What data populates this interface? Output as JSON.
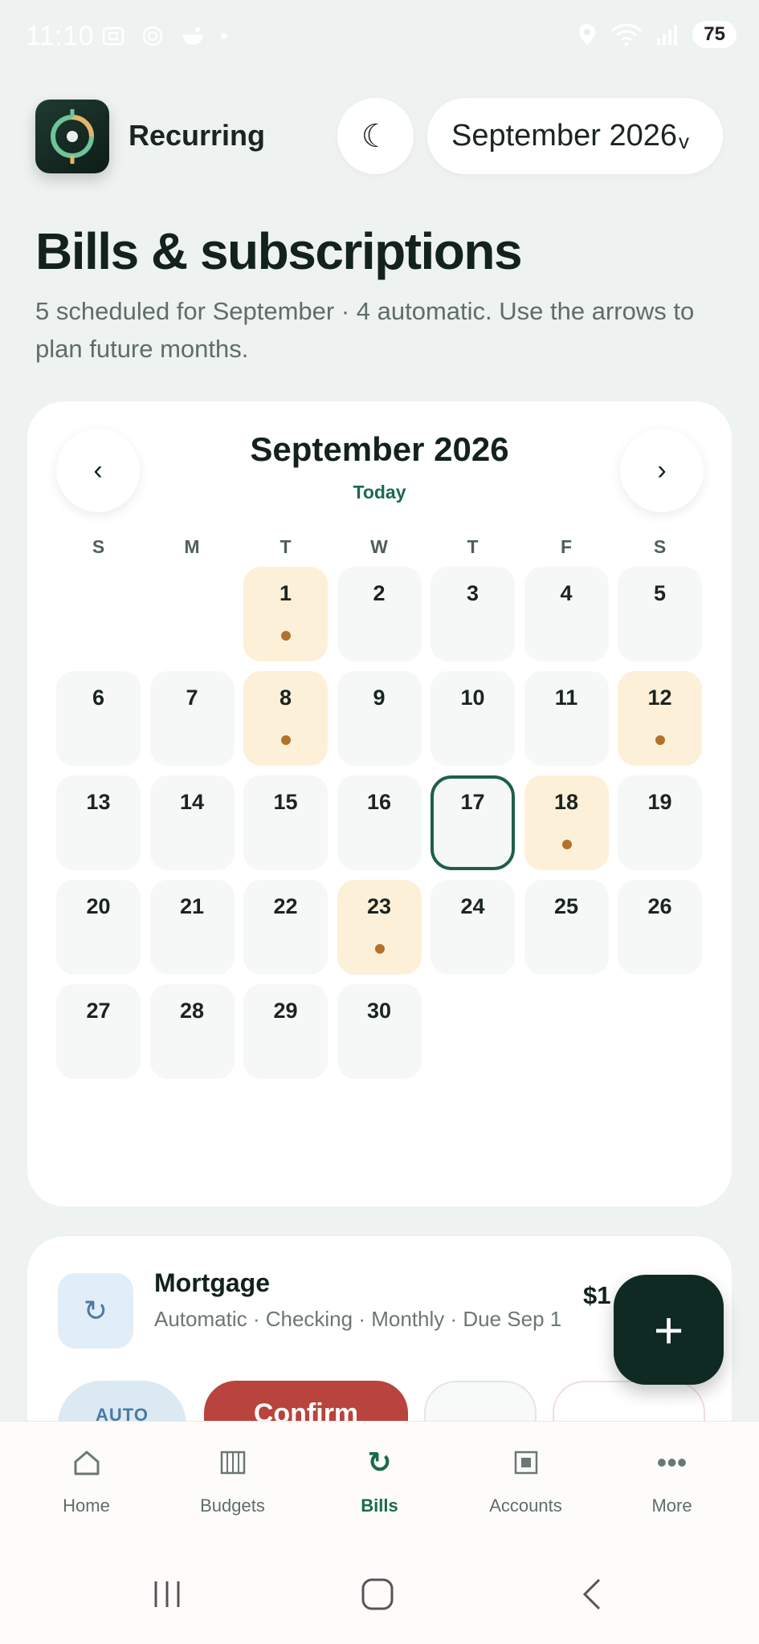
{
  "status_bar": {
    "time": "11:10",
    "battery": "75",
    "left_icons": [
      "screenshot-icon",
      "openai-icon",
      "bowl-icon",
      "dot-icon"
    ],
    "right_icons": [
      "location-icon",
      "wifi-icon",
      "signal-icon"
    ]
  },
  "header": {
    "app_name": "Recurring",
    "theme_icon": "☾",
    "month_selector": "September 2026",
    "month_selector_chevron": "v"
  },
  "page": {
    "title": "Bills & subscriptions",
    "subtitle": "5 scheduled for September · 4 automatic. Use the arrows to plan future months."
  },
  "calendar": {
    "title": "September 2026",
    "today_link": "Today",
    "prev_label": "‹",
    "next_label": "›",
    "weekdays": [
      "S",
      "M",
      "T",
      "W",
      "T",
      "F",
      "S"
    ],
    "leading_blanks": 2,
    "days": [
      "1",
      "2",
      "3",
      "4",
      "5",
      "6",
      "7",
      "8",
      "9",
      "10",
      "11",
      "12",
      "13",
      "14",
      "15",
      "16",
      "17",
      "18",
      "19",
      "20",
      "21",
      "22",
      "23",
      "24",
      "25",
      "26",
      "27",
      "28",
      "29",
      "30"
    ],
    "bill_days": [
      1,
      8,
      12,
      18,
      23
    ],
    "today": 17,
    "colors": {
      "bill_bg": "#fdf0d8",
      "dot": "#b3722b",
      "today_border": "#1f5f48"
    }
  },
  "bill": {
    "icon": "↻",
    "name": "Mortgage",
    "meta": "Automatic · Checking · Monthly · Due Sep 1",
    "amount": "$1",
    "auto_label": "AUTO",
    "confirm_label": "Confirm"
  },
  "fab": {
    "label": "+"
  },
  "bottom_nav": {
    "items": [
      {
        "label": "Home",
        "icon": "⌂"
      },
      {
        "label": "Budgets",
        "icon": "▥"
      },
      {
        "label": "Bills",
        "icon": "↻"
      },
      {
        "label": "Accounts",
        "icon": "▣"
      },
      {
        "label": "More",
        "icon": "•••"
      }
    ],
    "active": "Bills"
  },
  "system_nav": {
    "recents": "|||",
    "home": "▢",
    "back": "‹"
  },
  "colors": {
    "accent": "#1b6a4d",
    "danger": "#b9433d",
    "fab": "#0f2a22",
    "background": "#eef2f1"
  }
}
